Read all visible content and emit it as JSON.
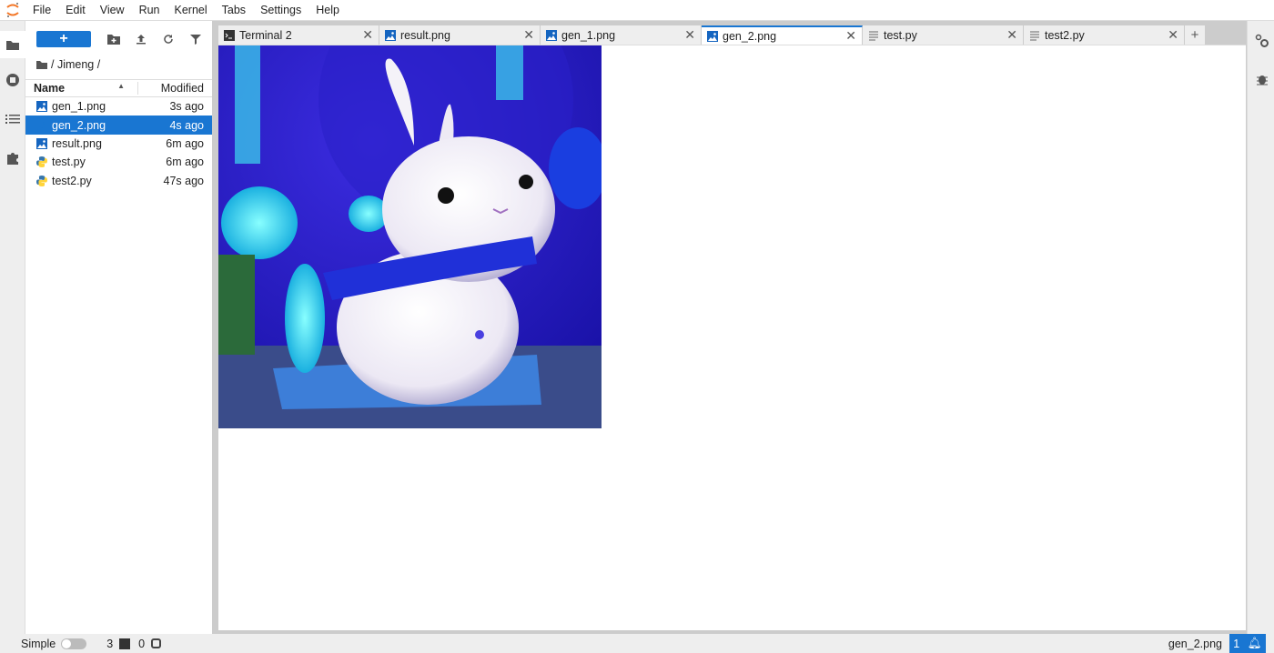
{
  "menu": [
    "File",
    "Edit",
    "View",
    "Run",
    "Kernel",
    "Tabs",
    "Settings",
    "Help"
  ],
  "filebrowser": {
    "new_label": "+",
    "breadcrumb": "/ Jimeng /",
    "columns": {
      "name": "Name",
      "modified": "Modified"
    },
    "files": [
      {
        "name": "gen_1.png",
        "modified": "3s ago",
        "type": "image",
        "selected": false
      },
      {
        "name": "gen_2.png",
        "modified": "4s ago",
        "type": "image",
        "selected": true
      },
      {
        "name": "result.png",
        "modified": "6m ago",
        "type": "image",
        "selected": false
      },
      {
        "name": "test.py",
        "modified": "6m ago",
        "type": "python",
        "selected": false
      },
      {
        "name": "test2.py",
        "modified": "47s ago",
        "type": "python",
        "selected": false
      }
    ]
  },
  "tabs": [
    {
      "label": "Terminal 2",
      "icon": "terminal-icon",
      "active": false
    },
    {
      "label": "result.png",
      "icon": "image-icon",
      "active": false
    },
    {
      "label": "gen_1.png",
      "icon": "image-icon",
      "active": false
    },
    {
      "label": "gen_2.png",
      "icon": "image-icon",
      "active": true
    },
    {
      "label": "test.py",
      "icon": "text-file-icon",
      "active": false
    },
    {
      "label": "test2.py",
      "icon": "text-file-icon",
      "active": false
    }
  ],
  "status": {
    "mode": "Simple",
    "terminals": "3",
    "kernels": "0",
    "current_file": "gen_2.png",
    "notifications": "1"
  },
  "colors": {
    "accent": "#1976d2"
  }
}
